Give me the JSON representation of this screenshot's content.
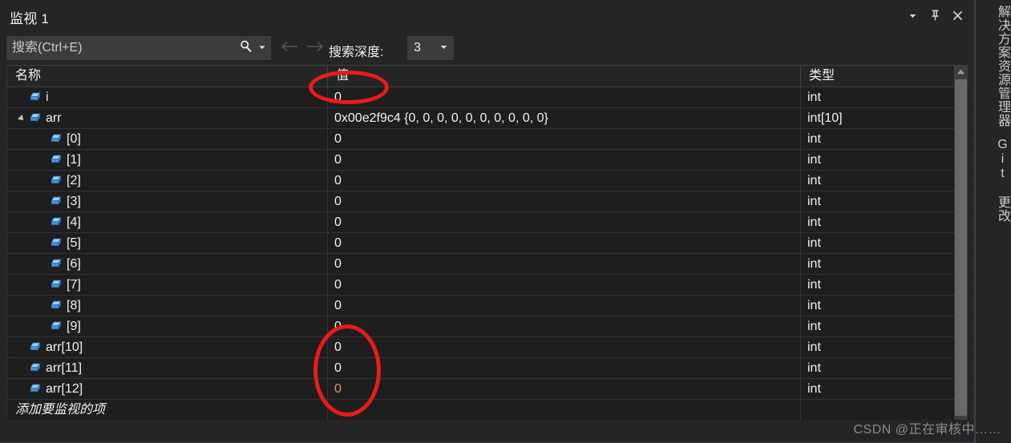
{
  "window": {
    "title": "监视 1",
    "buttons": [
      {
        "name": "window-dropdown",
        "icon": "chevron-down-icon",
        "label": "▾"
      },
      {
        "name": "window-pin",
        "icon": "pin-icon",
        "label": "📌"
      },
      {
        "name": "window-close",
        "icon": "close-icon",
        "label": "✕"
      }
    ]
  },
  "toolbar": {
    "search_placeholder": "搜索(Ctrl+E)",
    "search_value": "",
    "search_icon": "search-icon",
    "search_dropdown_icon": "chevron-down-icon",
    "back_icon": "arrow-left-icon",
    "forward_icon": "arrow-right-icon",
    "depth_label": "搜索深度:",
    "depth_value": "3",
    "depth_caret_icon": "chevron-down-icon"
  },
  "grid": {
    "columns": [
      "名称",
      "值",
      "类型"
    ],
    "rows": [
      {
        "name": "i",
        "value": "0",
        "type": "int",
        "indent": 1,
        "expander": "none",
        "icon": "variable-icon",
        "changed": false
      },
      {
        "name": "arr",
        "value": "0x00e2f9c4 {0, 0, 0, 0, 0, 0, 0, 0, 0, 0}",
        "type": "int[10]",
        "indent": 1,
        "expander": "expanded",
        "icon": "variable-icon",
        "changed": false
      },
      {
        "name": "[0]",
        "value": "0",
        "type": "int",
        "indent": 2,
        "expander": "none",
        "icon": "variable-icon",
        "changed": false
      },
      {
        "name": "[1]",
        "value": "0",
        "type": "int",
        "indent": 2,
        "expander": "none",
        "icon": "variable-icon",
        "changed": false
      },
      {
        "name": "[2]",
        "value": "0",
        "type": "int",
        "indent": 2,
        "expander": "none",
        "icon": "variable-icon",
        "changed": false
      },
      {
        "name": "[3]",
        "value": "0",
        "type": "int",
        "indent": 2,
        "expander": "none",
        "icon": "variable-icon",
        "changed": false
      },
      {
        "name": "[4]",
        "value": "0",
        "type": "int",
        "indent": 2,
        "expander": "none",
        "icon": "variable-icon",
        "changed": false
      },
      {
        "name": "[5]",
        "value": "0",
        "type": "int",
        "indent": 2,
        "expander": "none",
        "icon": "variable-icon",
        "changed": false
      },
      {
        "name": "[6]",
        "value": "0",
        "type": "int",
        "indent": 2,
        "expander": "none",
        "icon": "variable-icon",
        "changed": false
      },
      {
        "name": "[7]",
        "value": "0",
        "type": "int",
        "indent": 2,
        "expander": "none",
        "icon": "variable-icon",
        "changed": false
      },
      {
        "name": "[8]",
        "value": "0",
        "type": "int",
        "indent": 2,
        "expander": "none",
        "icon": "variable-icon",
        "changed": false
      },
      {
        "name": "[9]",
        "value": "0",
        "type": "int",
        "indent": 2,
        "expander": "none",
        "icon": "variable-icon",
        "changed": false
      },
      {
        "name": "arr[10]",
        "value": "0",
        "type": "int",
        "indent": 1,
        "expander": "none",
        "icon": "variable-icon",
        "changed": false
      },
      {
        "name": "arr[11]",
        "value": "0",
        "type": "int",
        "indent": 1,
        "expander": "none",
        "icon": "variable-icon",
        "changed": false
      },
      {
        "name": "arr[12]",
        "value": "0",
        "type": "int",
        "indent": 1,
        "expander": "none",
        "icon": "variable-icon",
        "changed": true
      }
    ],
    "add_watch_placeholder": "添加要监视的项"
  },
  "right_strip": {
    "tabs": [
      {
        "name": "solution-explorer",
        "label": "解决方案资源管理器"
      },
      {
        "name": "git-changes",
        "label": "Git 更改"
      }
    ]
  },
  "annotations": [
    {
      "name": "value-column-header-highlight",
      "shape": "ellipse"
    },
    {
      "name": "value-column-cells-highlight",
      "shape": "ellipse"
    }
  ],
  "watermark": "CSDN @正在审核中……",
  "colors": {
    "window_bg": "#252526",
    "grid_bg": "#1e1e1e",
    "text": "#f1f1f1",
    "changed_value": "#e08a7a",
    "icon_blue": "#4a90d9",
    "annotation_red": "#e81b1b",
    "scrollbar_thumb": "#686868"
  }
}
